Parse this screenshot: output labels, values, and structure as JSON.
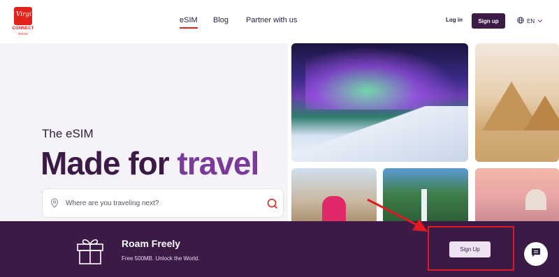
{
  "header": {
    "logo_brand": "CONNECT",
    "logo_sub": "ROAM",
    "logo_mark": "Virgin",
    "nav": [
      {
        "label": "eSIM",
        "active": true
      },
      {
        "label": "Blog"
      },
      {
        "label": "Partner with us"
      }
    ],
    "login_label": "Log in",
    "signup_label": "Sign up",
    "language": "EN"
  },
  "hero": {
    "subtitle": "The eSIM",
    "title_part1": "Made for ",
    "title_part2": "travel",
    "search_placeholder": "Where are you traveling next?"
  },
  "banner": {
    "title": "Roam Freely",
    "subtitle": "Free 500MB. Unlock the World.",
    "signup_label": "Sign Up"
  },
  "icons": {
    "gift": "gift-icon",
    "chat": "chat-icon",
    "location": "location-pin-icon",
    "search": "search-icon",
    "globe": "globe-icon"
  },
  "colors": {
    "brand_red": "#e2231a",
    "deep_purple": "#3b1a46",
    "accent_purple": "#7a3a9a",
    "annotation_red": "#e01a22"
  }
}
